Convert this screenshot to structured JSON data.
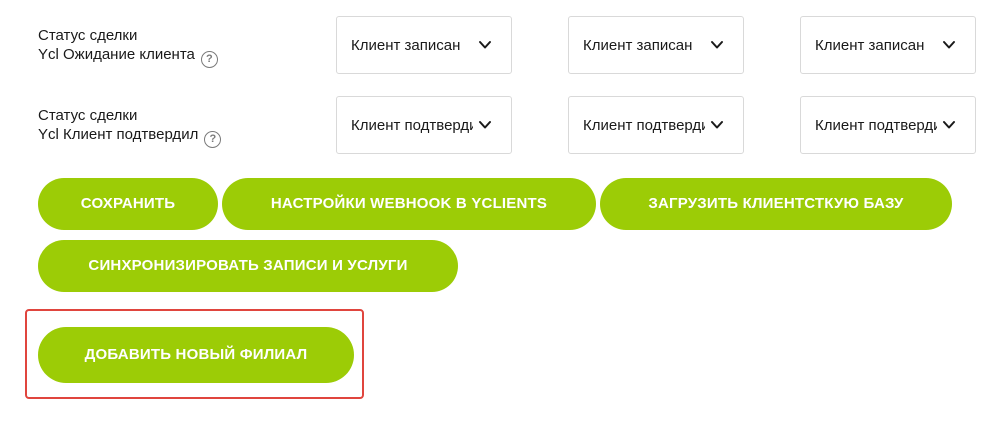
{
  "fields": [
    {
      "label_line1": "Статус сделки",
      "label_line2": "Ycl Ожидание клиента",
      "help_icon": "?",
      "selects": [
        "Клиент записан",
        "Клиент записан",
        "Клиент записан"
      ]
    },
    {
      "label_line1": "Статус сделки",
      "label_line2": "Ycl Клиент подтвердил",
      "help_icon": "?",
      "selects": [
        "Клиент подтвердил",
        "Клиент подтвердил",
        "Клиент подтвердил"
      ]
    }
  ],
  "buttons": {
    "save": "СОХРАНИТЬ",
    "webhook": "НАСТРОЙКИ WEBHOOK В YCLIENTS",
    "upload": "ЗАГРУЗИТЬ КЛИЕНТСТКУЮ БАЗУ",
    "sync": "СИНХРОНИЗИРОВАТЬ ЗАПИСИ И УСЛУГИ",
    "add_branch": "ДОБАВИТЬ НОВЫЙ ФИЛИАЛ"
  },
  "colors": {
    "button_bg": "#9ccc06",
    "button_text": "#ffffff",
    "highlight": "#e0453e"
  },
  "icons": {
    "help": "question-circle-icon",
    "chevron": "chevron-down-icon"
  }
}
